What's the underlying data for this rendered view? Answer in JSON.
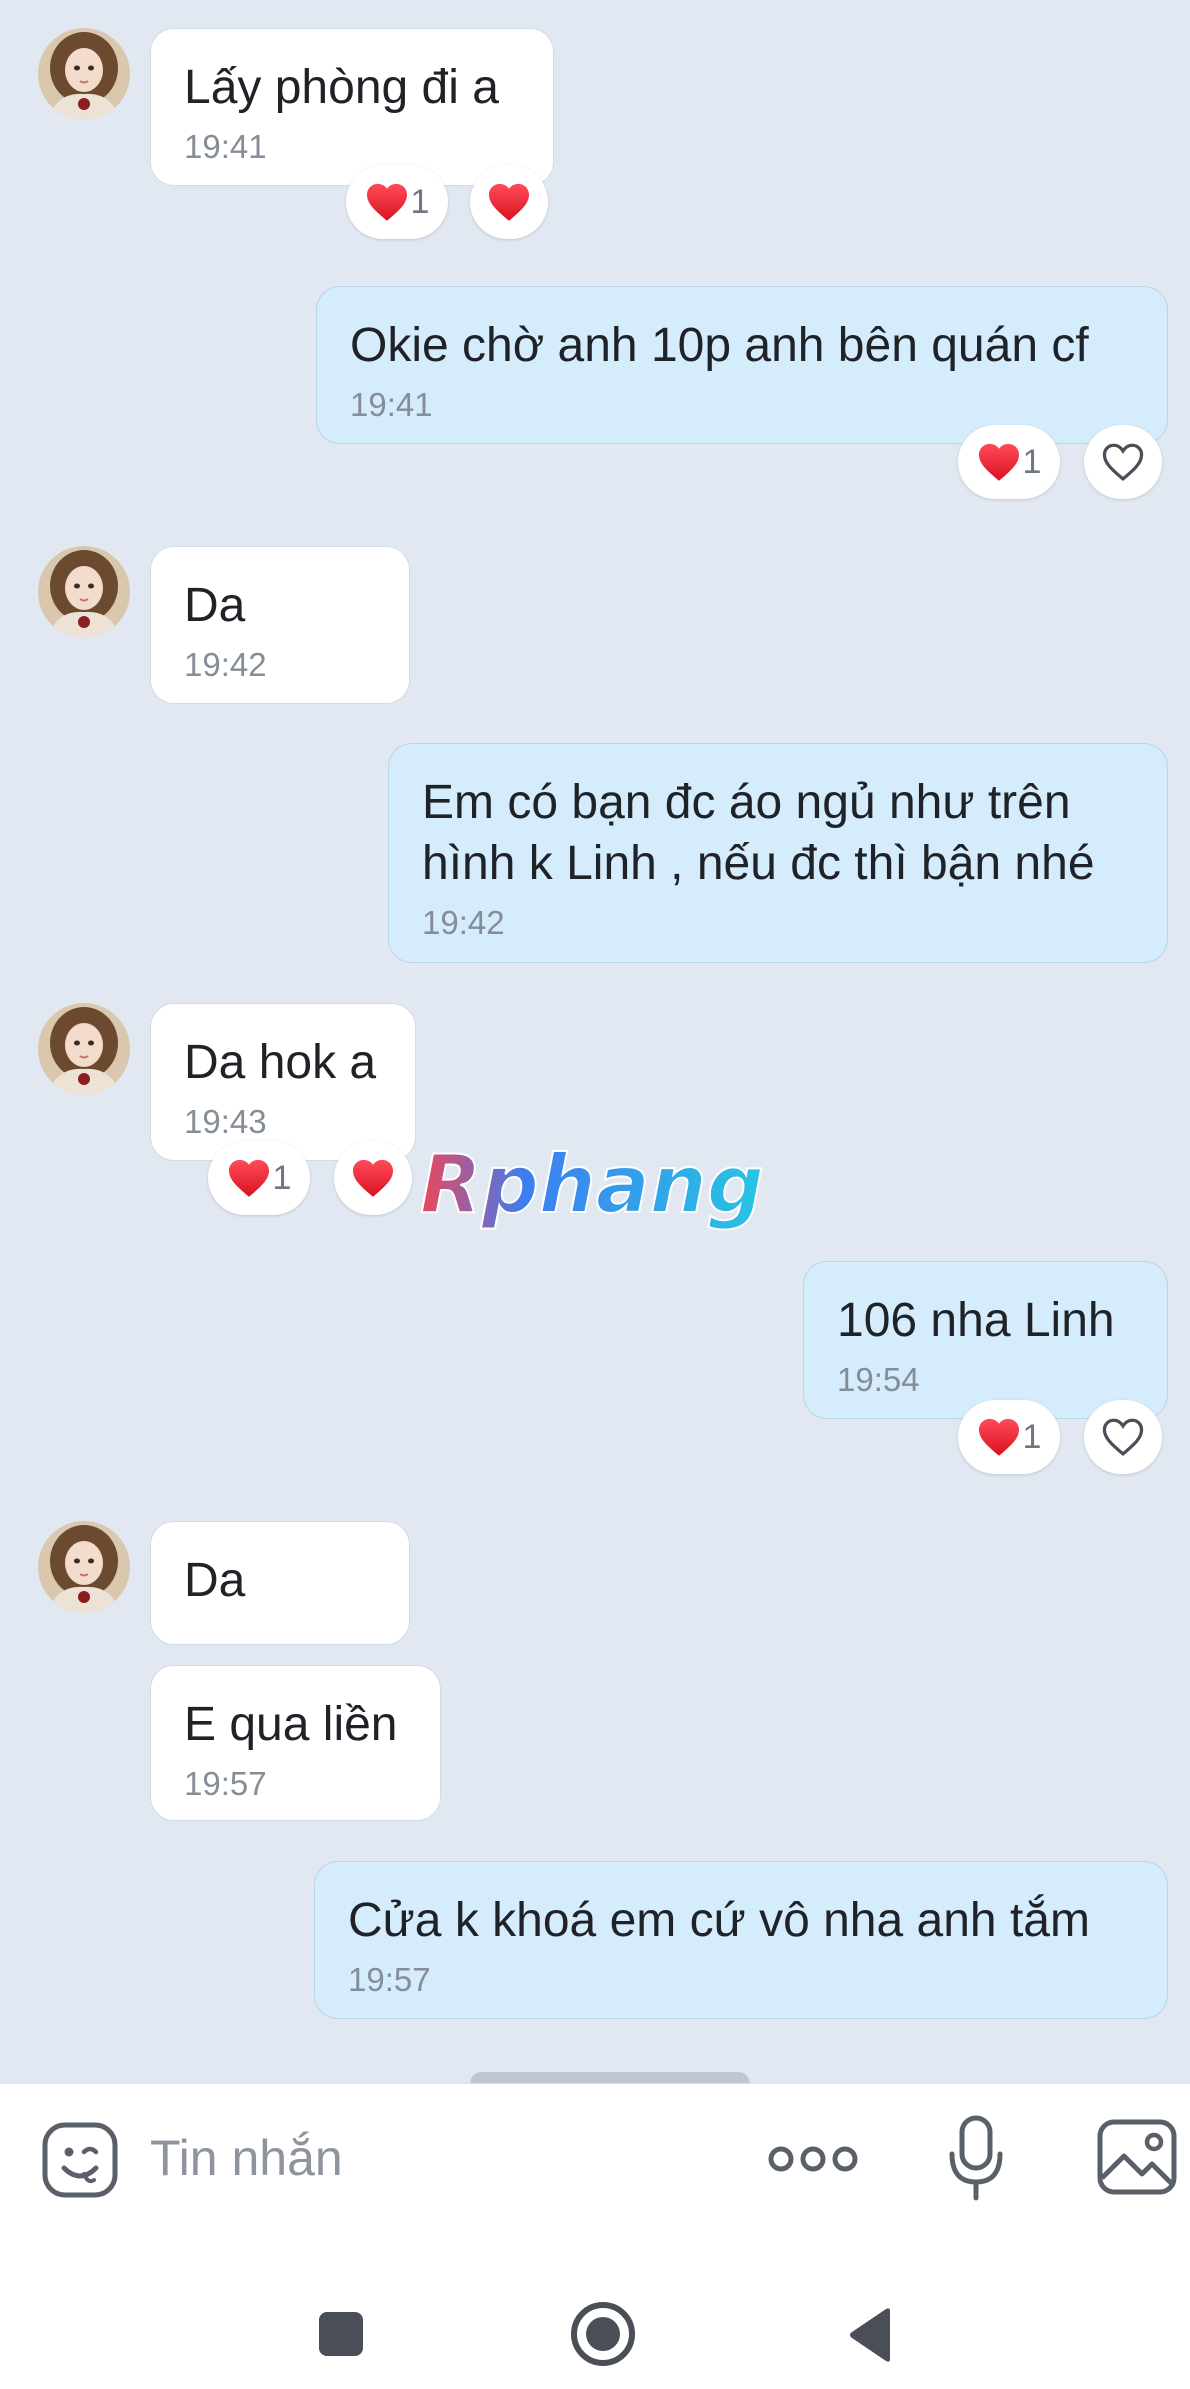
{
  "messages": [
    {
      "text": "Lấy phòng đi a",
      "time": "19:41"
    },
    {
      "text": "Okie chờ anh 10p anh bên quán cf",
      "time": "19:41"
    },
    {
      "text": "Da",
      "time": "19:42"
    },
    {
      "line1": "Em có bạn đc áo ngủ như trên",
      "line2": "hình k Linh , nếu đc thì bận nhé",
      "time": "19:42"
    },
    {
      "text": "Da hok a",
      "time": "19:43"
    },
    {
      "text": "106 nha Linh",
      "time": "19:54"
    },
    {
      "text": "Da"
    },
    {
      "text": "E qua liền",
      "time": "19:57"
    },
    {
      "text": "Cửa k khoá em cứ vô nha anh tắm",
      "time": "19:57"
    }
  ],
  "reactions": {
    "count": "1"
  },
  "watermark": "Rphang",
  "composer": {
    "placeholder": "Tin nhắn"
  },
  "colors": {
    "incoming": "#ffffff",
    "outgoing": "#d5ecfc",
    "background": "#e1e8f2",
    "heart": "#e8202f"
  },
  "icons": [
    "sticker-icon",
    "more-icon",
    "microphone-icon",
    "image-icon",
    "recent-apps-icon",
    "home-icon",
    "back-icon",
    "heart-icon",
    "heart-outline-icon"
  ]
}
